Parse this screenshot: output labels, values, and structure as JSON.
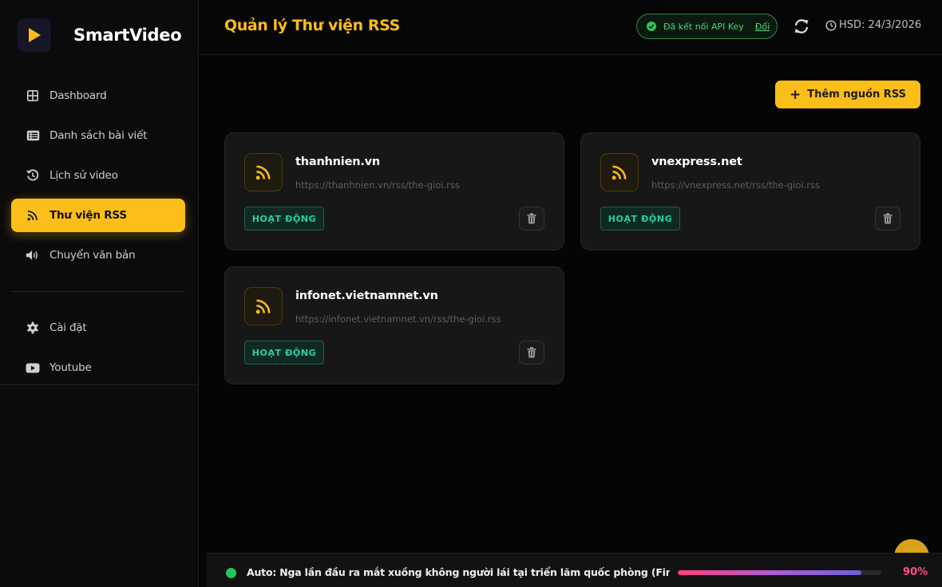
{
  "brand": {
    "name": "SmartVideo"
  },
  "sidebar": {
    "items": [
      {
        "label": "Dashboard",
        "icon": "grid-icon",
        "active": false
      },
      {
        "label": "Danh sách bài viết",
        "icon": "list-icon",
        "active": false
      },
      {
        "label": "Lịch sử video",
        "icon": "history-icon",
        "active": false
      },
      {
        "label": "Thư viện RSS",
        "icon": "rss-icon",
        "active": true
      },
      {
        "label": "Chuyển văn bản",
        "icon": "volume-icon",
        "active": false
      }
    ],
    "secondary": [
      {
        "label": "Cài đặt",
        "icon": "gear-icon"
      },
      {
        "label": "Youtube",
        "icon": "youtube-icon"
      }
    ]
  },
  "header": {
    "title": "Quản lý Thư viện RSS",
    "api_status": "Đã kết nối API Key",
    "api_change": "Đổi",
    "expiry": "HSD: 24/3/2026"
  },
  "main": {
    "add_button": "Thêm nguồn RSS",
    "feeds": [
      {
        "name": "thanhnien.vn",
        "url": "https://thanhnien.vn/rss/the-gioi.rss",
        "status": "HOẠT ĐỘNG"
      },
      {
        "name": "vnexpress.net",
        "url": "https://vnexpress.net/rss/the-gioi.rss",
        "status": "HOẠT ĐỘNG"
      },
      {
        "name": "infonet.vietnamnet.vn",
        "url": "https://infonet.vietnamnet.vn/rss/the-gioi.rss",
        "status": "HOẠT ĐỘNG"
      }
    ]
  },
  "task": {
    "text": "Auto: Nga lần đầu ra mắt xuồng không người lái tại triển lãm quốc phòng (Finalizing...",
    "progress": 90,
    "progress_label": "90%"
  },
  "colors": {
    "accent": "#fbbd18",
    "active_status": "#2ad1a2",
    "connected": "#31c15a",
    "progress_text": "#ff4f86"
  }
}
